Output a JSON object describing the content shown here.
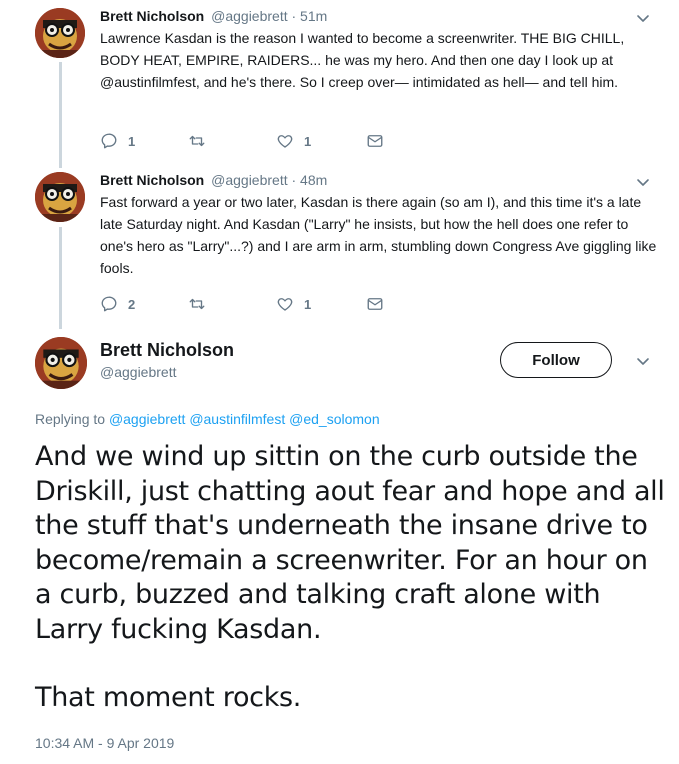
{
  "tweets": [
    {
      "name": "Brett Nicholson",
      "handle": "@aggiebrett",
      "time": "· 51m",
      "text": "Lawrence Kasdan is the reason I wanted to become a screenwriter. THE BIG CHILL, BODY HEAT, EMPIRE, RAIDERS... he was my hero. And then one day I look up at @austinfilmfest, and he's there. So I creep over— intimidated as hell— and tell him.",
      "replies": "1",
      "retweets": "",
      "likes": "1"
    },
    {
      "name": "Brett Nicholson",
      "handle": "@aggiebrett",
      "time": "· 48m",
      "text": "Fast forward a year or two later, Kasdan is there again (so am I), and this time it's a late late Saturday night. And Kasdan (\"Larry\" he insists, but how the hell does one refer to one's hero as \"Larry\"...?) and I are arm in arm, stumbling down Congress Ave giggling like fools.",
      "replies": "2",
      "retweets": "",
      "likes": "1"
    }
  ],
  "main_tweet": {
    "name": "Brett Nicholson",
    "handle": "@aggiebrett",
    "follow_label": "Follow",
    "replying_prefix": "Replying to",
    "replying_to": [
      "@aggiebrett",
      "@austinfilmfest",
      "@ed_solomon"
    ],
    "paragraph1": "And we wind up sittin on the curb outside the Driskill, just chatting aout fear and hope and all the stuff that's underneath the insane drive to become/remain a screenwriter. For an hour on a curb, buzzed and talking craft alone with Larry fucking Kasdan.",
    "paragraph2": "That moment rocks.",
    "timestamp": "10:34 AM - 9 Apr 2019"
  },
  "colors": {
    "text": "#14171a",
    "secondary": "#657786",
    "link": "#1da1f2",
    "thread_line": "#ccd6dd"
  },
  "icons": [
    "reply-icon",
    "retweet-icon",
    "like-icon",
    "message-icon",
    "chevron-down-icon"
  ]
}
